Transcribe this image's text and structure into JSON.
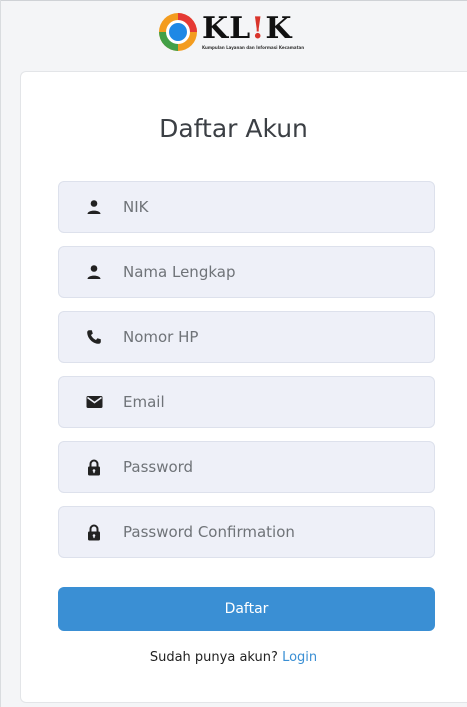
{
  "logo": {
    "word_part1": "KL",
    "word_bang": "!",
    "word_part2": "K",
    "tagline": "Kumpulan Layanan dan Informasi Kecamatan"
  },
  "form": {
    "title": "Daftar Akun",
    "fields": [
      {
        "icon": "user-icon",
        "placeholder": "NIK"
      },
      {
        "icon": "user-icon",
        "placeholder": "Nama Lengkap"
      },
      {
        "icon": "phone-icon",
        "placeholder": "Nomor HP"
      },
      {
        "icon": "envelope-icon",
        "placeholder": "Email"
      },
      {
        "icon": "lock-icon",
        "placeholder": "Password"
      },
      {
        "icon": "lock-icon",
        "placeholder": "Password Confirmation"
      }
    ],
    "submit_label": "Daftar",
    "login_prompt": "Sudah punya akun?",
    "login_link": "Login"
  },
  "colors": {
    "accent": "#3a8fd4",
    "field_bg": "#eef0f8",
    "page_bg": "#f4f5f7",
    "logo_red": "#d9342b"
  }
}
